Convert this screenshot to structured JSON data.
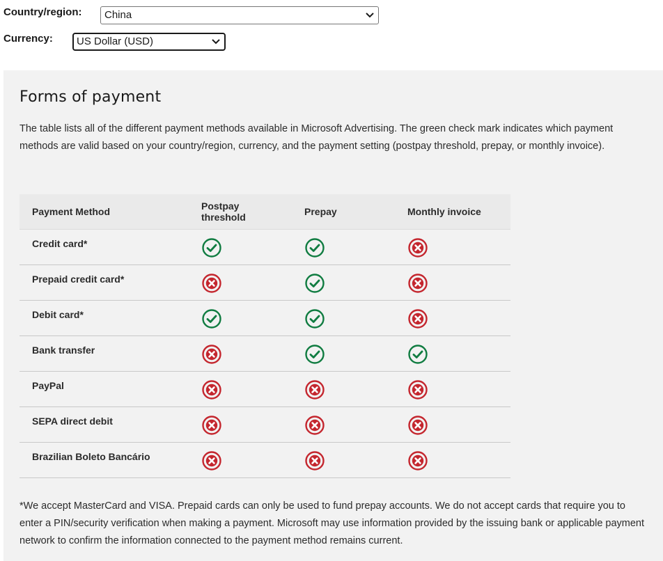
{
  "filters": {
    "country_label": "Country/region:",
    "country_value": "China",
    "currency_label": "Currency:",
    "currency_value": "US Dollar (USD)"
  },
  "section": {
    "title": "Forms of payment",
    "description": "The table lists all of the different payment methods available in Microsoft Advertising. The green check mark indicates which payment methods are valid based on your country/region, currency, and the payment setting (postpay threshold, prepay, or monthly invoice)."
  },
  "table": {
    "headers": [
      "Payment Method",
      "Postpay threshold",
      "Prepay",
      "Monthly invoice"
    ],
    "rows": [
      {
        "method": "Credit card*",
        "postpay": "check",
        "prepay": "check",
        "monthly": "cross"
      },
      {
        "method": "Prepaid credit card*",
        "postpay": "cross",
        "prepay": "check",
        "monthly": "cross"
      },
      {
        "method": "Debit card*",
        "postpay": "check",
        "prepay": "check",
        "monthly": "cross"
      },
      {
        "method": "Bank transfer",
        "postpay": "cross",
        "prepay": "check",
        "monthly": "check"
      },
      {
        "method": "PayPal",
        "postpay": "cross",
        "prepay": "cross",
        "monthly": "cross"
      },
      {
        "method": "SEPA direct debit",
        "postpay": "cross",
        "prepay": "cross",
        "monthly": "cross"
      },
      {
        "method": "Brazilian Boleto Bancário",
        "postpay": "cross",
        "prepay": "cross",
        "monthly": "cross"
      }
    ]
  },
  "footnote": "*We accept MasterCard and VISA. Prepaid cards can only be used to fund prepay accounts. We do not accept cards that require you to enter a PIN/security verification when making a payment. Microsoft may use information provided by the issuing bank or applicable payment network to confirm the information connected to the payment method remains current.",
  "colors": {
    "check": "#107c41",
    "cross": "#c4262e",
    "panel_bg": "#f2f2f2",
    "header_bg": "#eaeaea"
  },
  "icons": {
    "check": "check-circle-icon",
    "cross": "x-circle-icon",
    "dropdown": "chevron-down-icon"
  }
}
